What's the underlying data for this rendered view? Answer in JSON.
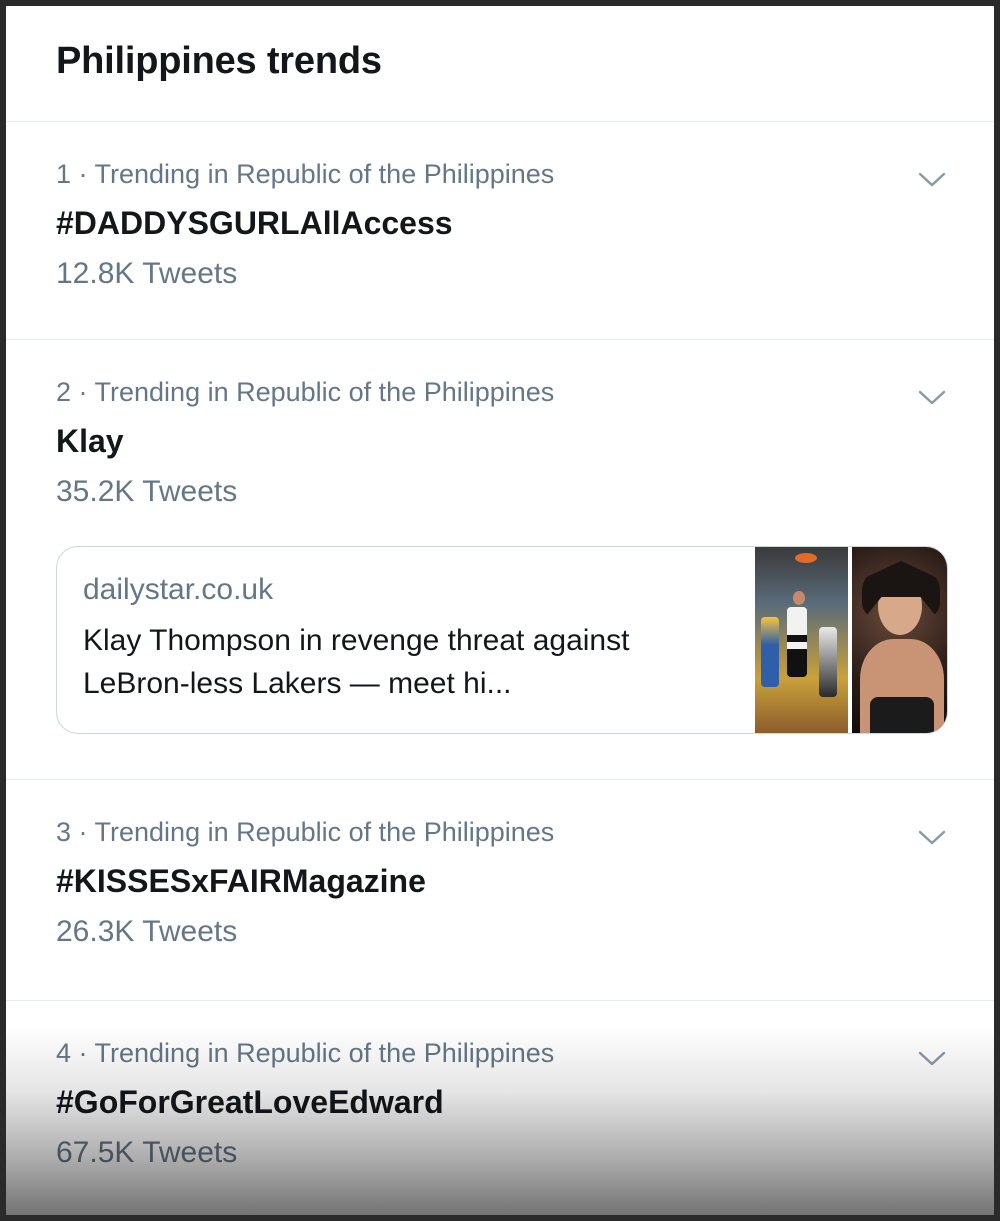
{
  "header": {
    "title": "Philippines trends"
  },
  "trends": [
    {
      "meta": "1 · Trending in Republic of the Philippines",
      "name": "#DADDYSGURLAllAccess",
      "count": "12.8K Tweets",
      "chevron_icon": "chevron-down-icon"
    },
    {
      "meta": "2 · Trending in Republic of the Philippines",
      "name": "Klay",
      "count": "35.2K Tweets",
      "chevron_icon": "chevron-down-icon",
      "card": {
        "domain": "dailystar.co.uk",
        "title": "Klay Thompson in revenge threat against LeBron-less Lakers — meet hi..."
      }
    },
    {
      "meta": "3 · Trending in Republic of the Philippines",
      "name": "#KISSESxFAIRMagazine",
      "count": "26.3K Tweets",
      "chevron_icon": "chevron-down-icon"
    },
    {
      "meta": "4 · Trending in Republic of the Philippines",
      "name": "#GoForGreatLoveEdward",
      "count": "67.5K Tweets",
      "chevron_icon": "chevron-down-icon"
    }
  ],
  "colors": {
    "primary_text": "#14171a",
    "secondary_text": "#657786",
    "divider": "#e6ecf0",
    "card_border": "#ccd6dd"
  }
}
